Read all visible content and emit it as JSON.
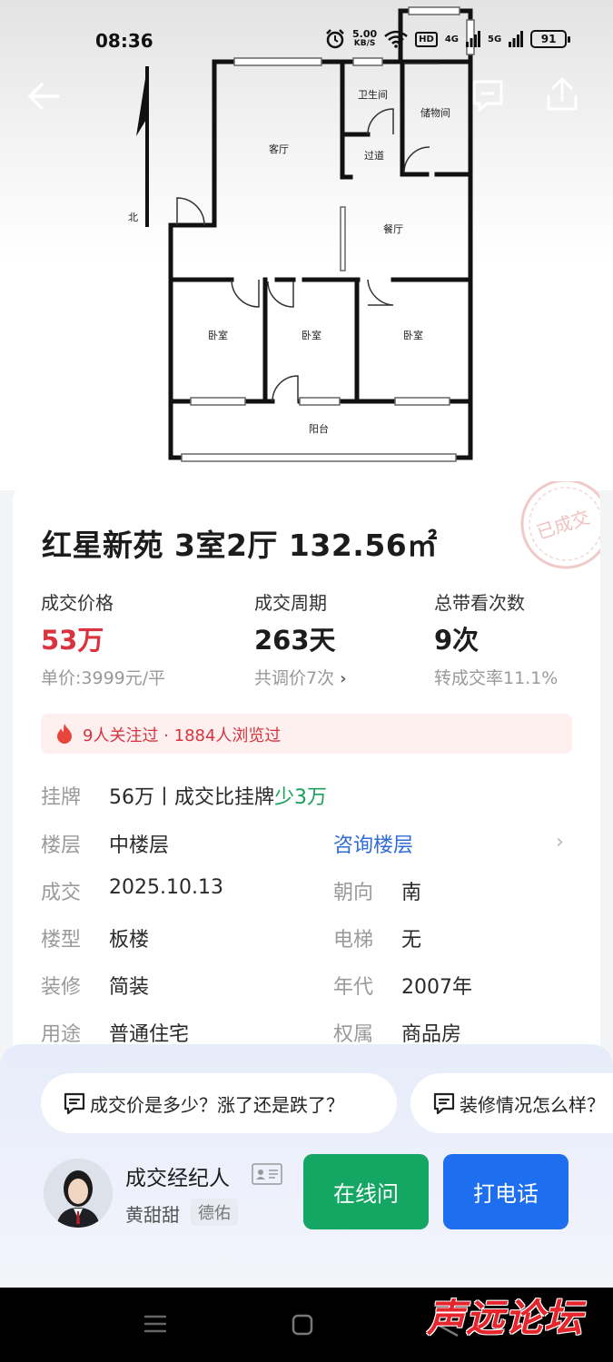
{
  "status_bar": {
    "time": "08:36",
    "speed_value": "5.00",
    "speed_unit": "KB/S",
    "hd": "HD",
    "net_4g": "4G",
    "net_5g": "5G",
    "battery": "91"
  },
  "floor_plan": {
    "north": "北",
    "rooms": {
      "living_room": "客厅",
      "bathroom": "卫生间",
      "storage": "储物间",
      "corridor": "过道",
      "dining": "餐厅",
      "bedroom_1": "卧室",
      "bedroom_2": "卧室",
      "bedroom_3": "卧室",
      "balcony": "阳台"
    }
  },
  "listing": {
    "stamp": "已成交",
    "title": "红星新苑 3室2厅 132.56㎡",
    "stats": [
      {
        "label": "成交价格",
        "value": "53万",
        "sub": "单价:3999元/平"
      },
      {
        "label": "成交周期",
        "value": "263天",
        "sub": "共调价7次"
      },
      {
        "label": "总带看次数",
        "value": "9次",
        "sub": "转成交率11.1%"
      }
    ],
    "hot_text": "9人关注过 · 1884人浏览过",
    "listing_row": {
      "label": "挂牌",
      "value_prefix": "56万丨成交比挂牌",
      "value_highlight": "少3万"
    },
    "details": {
      "floor_label": "楼层",
      "floor_value": "中楼层",
      "consult_floor": "咨询楼层",
      "deal_label": "成交",
      "deal_value": "2025.10.13",
      "orientation_label": "朝向",
      "orientation_value": "南",
      "building_label": "楼型",
      "building_value": "板楼",
      "elevator_label": "电梯",
      "elevator_value": "无",
      "decor_label": "装修",
      "decor_value": "简装",
      "year_label": "年代",
      "year_value": "2007年",
      "usage_label": "用途",
      "usage_value": "普通住宅",
      "ownership_label": "权属",
      "ownership_value": "商品房"
    }
  },
  "questions": [
    "成交价是多少？涨了还是跌了？",
    "装修情况怎么样？"
  ],
  "agent": {
    "title": "成交经纪人",
    "name": "黄甜甜",
    "company": "德佑",
    "online_button": "在线问",
    "call_button": "打电话"
  },
  "watermark": "声远论坛",
  "colors": {
    "price_red": "#d9333f",
    "saving_green": "#19a05b",
    "link_blue": "#2f6bd8",
    "online_green": "#13a763",
    "call_blue": "#1e6ef0"
  }
}
